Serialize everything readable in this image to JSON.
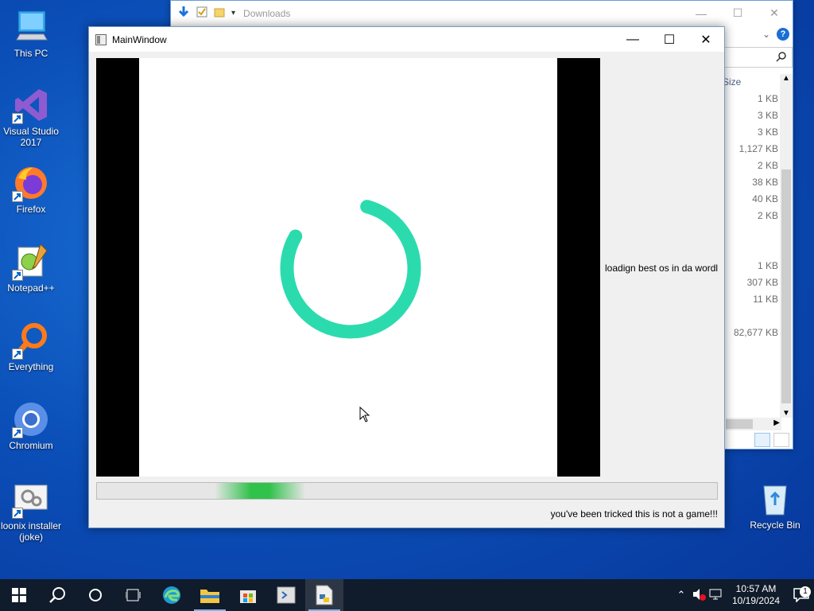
{
  "desktop": {
    "icons": [
      {
        "label": "This PC"
      },
      {
        "label": "Visual Studio 2017"
      },
      {
        "label": "Firefox"
      },
      {
        "label": "Notepad++"
      },
      {
        "label": "Everything"
      },
      {
        "label": "Chromium"
      },
      {
        "label": "loonix installer (joke)"
      }
    ],
    "recycle_bin": {
      "label": "Recycle Bin"
    }
  },
  "explorer": {
    "title": "Downloads",
    "column_header": "Size",
    "sizes": [
      "1 KB",
      "3 KB",
      "3 KB",
      "1,127 KB",
      "2 KB",
      "38 KB",
      "40 KB",
      "2 KB",
      "",
      "",
      "1 KB",
      "307 KB",
      "11 KB",
      "",
      "82,677 KB"
    ],
    "help_label": "?"
  },
  "main_window": {
    "title": "MainWindow",
    "side_label": "loadign best os in da wordl",
    "bottom_label": "you've been tricked this is not a game!!!",
    "progress_chunk_fraction": 0.19,
    "spinner_color": "#2bdbae"
  },
  "taskbar": {
    "time": "10:57 AM",
    "date": "10/19/2024",
    "notification_count": "1"
  }
}
